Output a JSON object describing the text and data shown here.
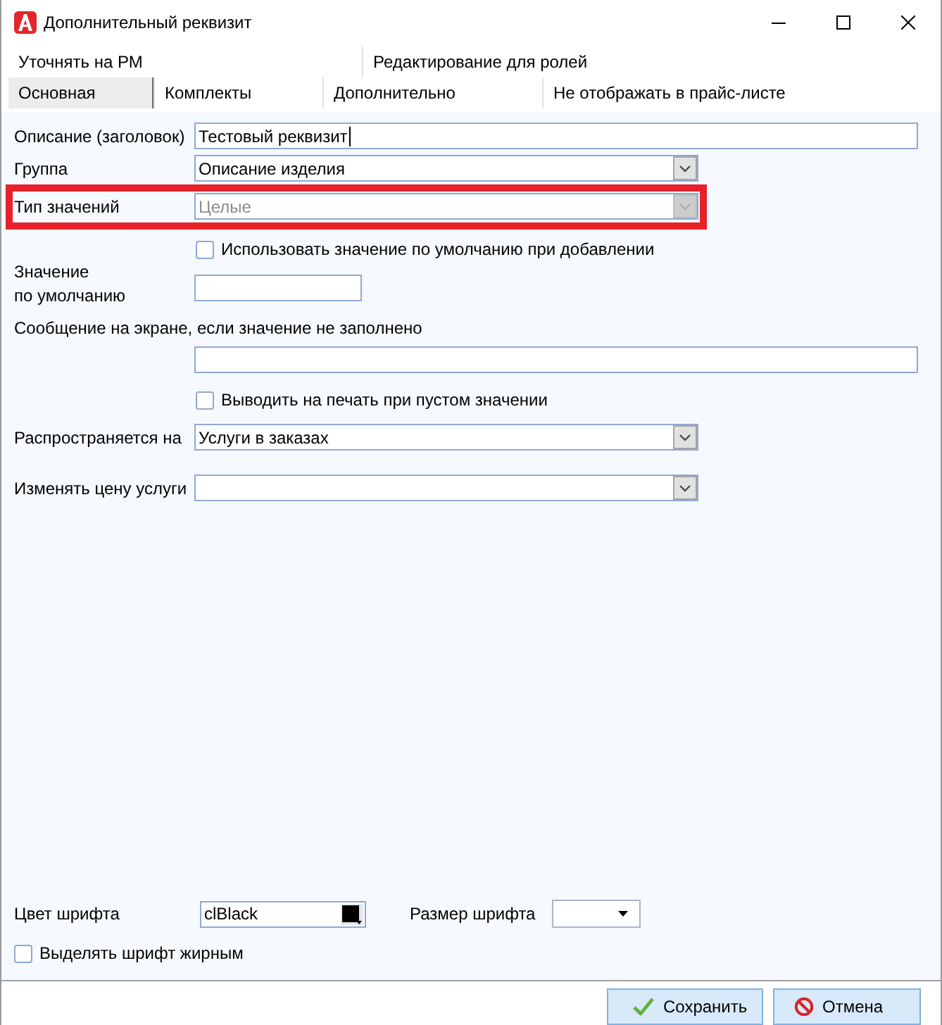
{
  "window": {
    "title": "Дополнительный реквизит"
  },
  "tab_rows": [
    {
      "tabs": [
        {
          "label": "Уточнять на РМ",
          "selected": false
        },
        {
          "label": "Редактирование для ролей",
          "selected": false
        }
      ]
    },
    {
      "tabs": [
        {
          "label": "Основная",
          "selected": true
        },
        {
          "label": "Комплекты",
          "selected": false
        },
        {
          "label": "Дополнительно",
          "selected": false
        },
        {
          "label": "Не отображать в прайс-листе",
          "selected": false
        }
      ]
    }
  ],
  "fields": [
    {
      "kind": "text",
      "label": "Описание (заголовок)",
      "value": "Тестовый реквизит",
      "focused": true,
      "highlighted": false
    },
    {
      "kind": "select",
      "label": "Группа",
      "value": "Описание изделия",
      "disabled": false,
      "highlighted": false
    },
    {
      "kind": "select",
      "label": "Тип значений",
      "value": "Целые",
      "disabled": true,
      "highlighted": true
    },
    {
      "kind": "checkbox",
      "label": "Использовать значение по умолчанию при добавлении",
      "checked": false,
      "highlighted": false
    },
    {
      "kind": "short_text",
      "label": "Значение\nпо умолчанию",
      "focused": false,
      "highlighted": false
    },
    {
      "kind": "stacked_text",
      "label": "Сообщение на экране, если значение не заполнено",
      "focused": false,
      "highlighted": false
    },
    {
      "kind": "checkbox",
      "label": "Выводить на печать при пустом значении",
      "checked": false,
      "highlighted": false
    },
    {
      "kind": "select",
      "label": "Распространяется на",
      "value": "Услуги в заказах",
      "disabled": false,
      "highlighted": false
    },
    {
      "kind": "select",
      "label": "Изменять цену услуги",
      "disabled": false,
      "highlighted": false
    }
  ],
  "font_settings": {
    "color_label": "Цвет шрифта",
    "color_value": "clBlack",
    "size_label": "Размер шрифта",
    "bold": {
      "label": "Выделять шрифт жирным",
      "checked": false
    }
  },
  "buttons": [
    {
      "kind": "save",
      "label": "Сохранить"
    },
    {
      "kind": "cancel",
      "label": "Отмена"
    }
  ]
}
